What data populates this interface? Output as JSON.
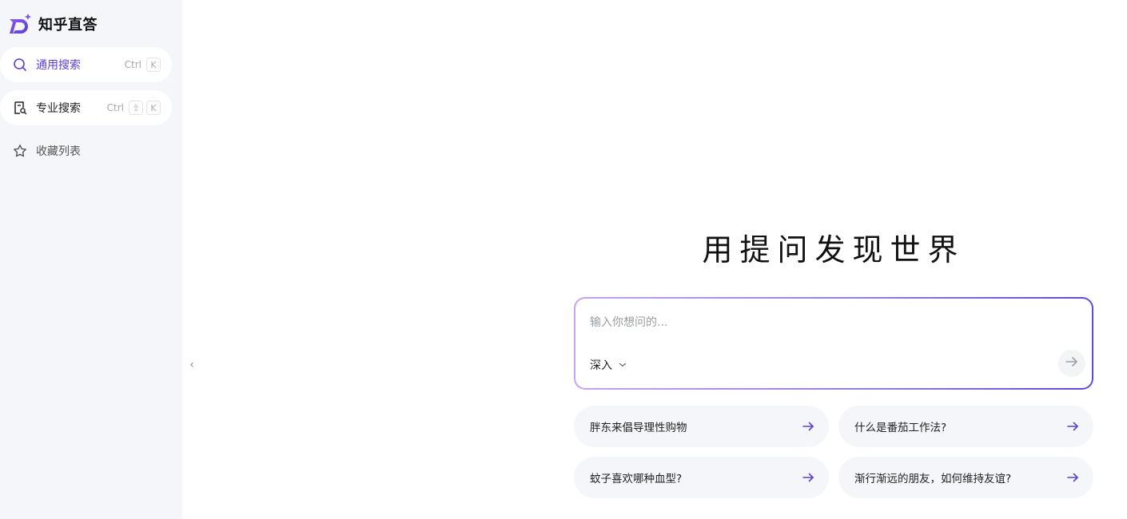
{
  "app": {
    "name": "知乎直答"
  },
  "sidebar": {
    "items": [
      {
        "label": "通用搜索",
        "icon": "search-icon",
        "shortcut_text": "Ctrl",
        "shortcut_keys": [
          "K"
        ],
        "active": true
      },
      {
        "label": "专业搜索",
        "icon": "document-search-icon",
        "shortcut_text": "Ctrl",
        "shortcut_keys": [
          "⇧",
          "K"
        ],
        "active": false
      },
      {
        "label": "收藏列表",
        "icon": "star-icon",
        "active": false
      }
    ],
    "collapse_glyph": "‹"
  },
  "hero": {
    "title": "用提问发现世界"
  },
  "search": {
    "placeholder": "输入你想问的...",
    "value": "",
    "mode_label": "深入"
  },
  "suggestions": [
    "胖东来倡导理性购物",
    "什么是番茄工作法?",
    "蚊子喜欢哪种血型?",
    "渐行渐远的朋友，如何维持友谊?"
  ],
  "colors": {
    "accent": "#5b3fd6",
    "sidebar_bg": "#f5f6f9",
    "gradient_start": "#c7a4f0",
    "gradient_end": "#5c4cd6"
  }
}
